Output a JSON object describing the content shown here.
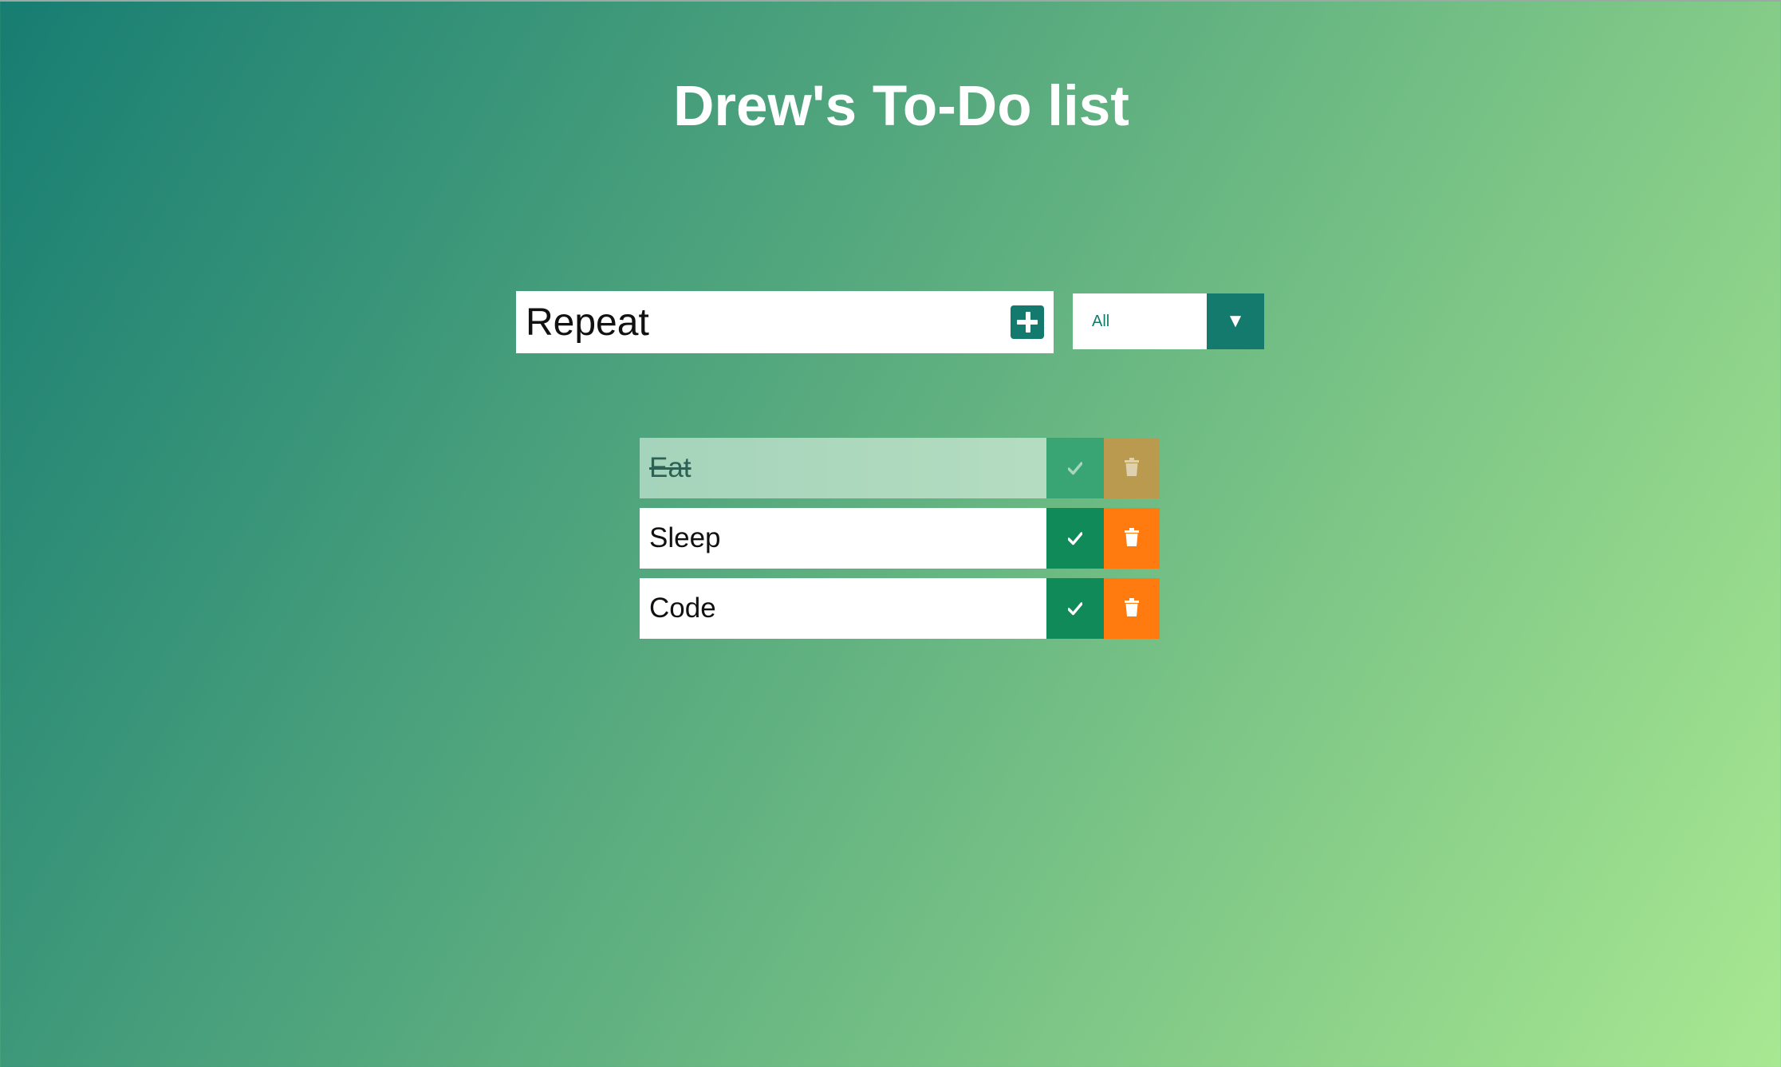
{
  "page": {
    "title": "Drew's To-Do list"
  },
  "form": {
    "input_value": "Repeat",
    "add_icon": "plus-square-icon",
    "filter": {
      "selected": "All",
      "arrow": "▼"
    }
  },
  "todos": [
    {
      "text": "Eat",
      "completed": true
    },
    {
      "text": "Sleep",
      "completed": false
    },
    {
      "text": "Code",
      "completed": false
    }
  ],
  "icons": {
    "complete": "check-icon",
    "delete": "trash-icon"
  },
  "colors": {
    "teal": "#157a6e",
    "complete_green": "#0f8a58",
    "delete_orange": "#ff7a0f",
    "gradient_start": "#177d72",
    "gradient_end": "#a8e892"
  }
}
